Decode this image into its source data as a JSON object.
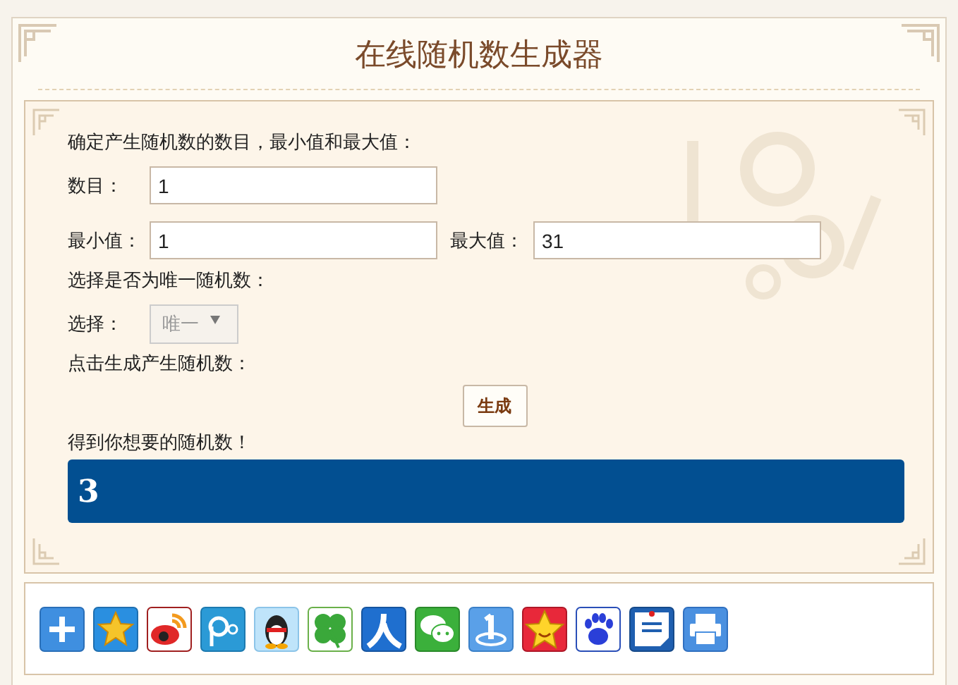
{
  "title": "在线随机数生成器",
  "instructions": "确定产生随机数的数目，最小值和最大值：",
  "count_field": {
    "label": "数目：",
    "value": "1"
  },
  "min_field": {
    "label": "最小值：",
    "value": "1"
  },
  "max_field": {
    "label": "最大值：",
    "value": "31"
  },
  "unique_prompt": "选择是否为唯一随机数：",
  "unique_select": {
    "label": "选择：",
    "value": "唯一",
    "disabled": true
  },
  "generate_prompt": "点击生成产生随机数：",
  "generate_button": "生成",
  "result_label": "得到你想要的随机数！",
  "result": "3"
}
